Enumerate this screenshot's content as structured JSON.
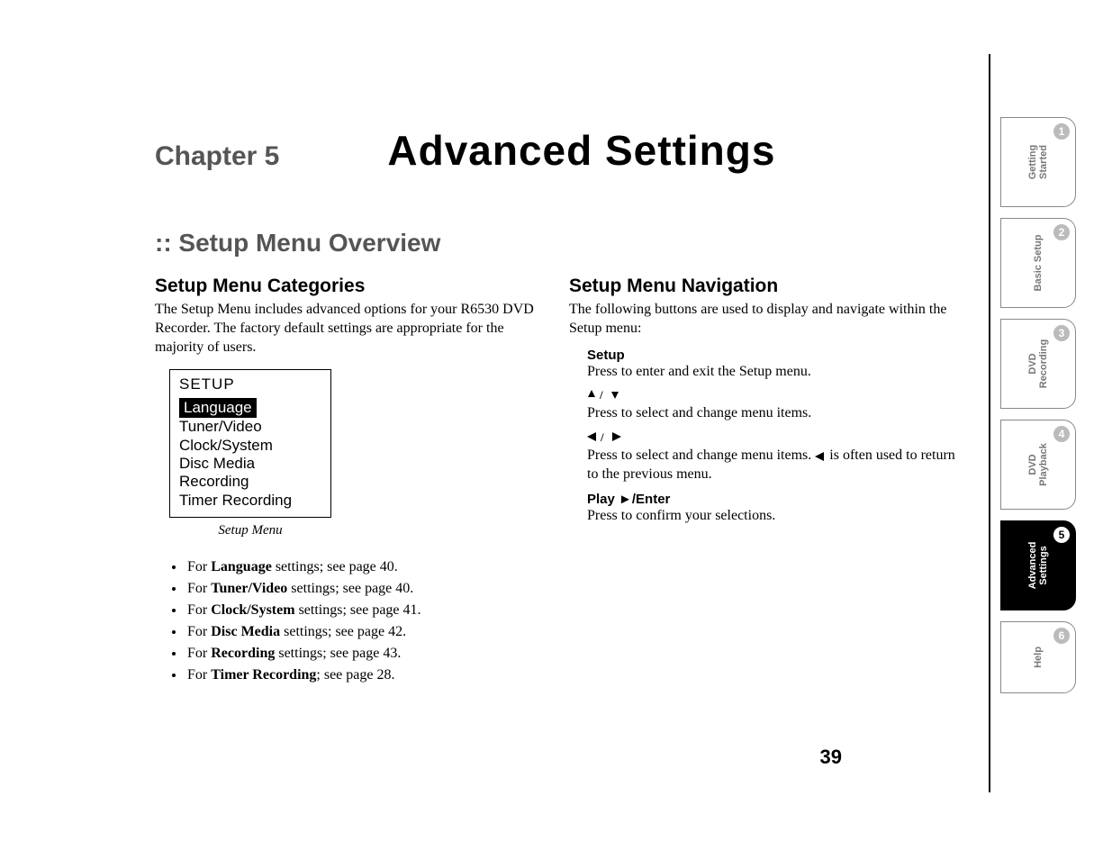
{
  "chapter": {
    "label": "Chapter 5",
    "title": "Advanced Settings"
  },
  "section_heading": ":: Setup Menu Overview",
  "left": {
    "heading": "Setup Menu Categories",
    "intro": "The Setup Menu includes advanced options for your R6530 DVD Recorder. The factory default settings are appropriate for the majority of users.",
    "menu": {
      "title": "SETUP",
      "items": [
        "Language",
        "Tuner/Video",
        "Clock/System",
        "Disc Media",
        "Recording",
        "Timer Recording"
      ],
      "caption": "Setup Menu"
    },
    "refs": [
      {
        "pre": "For ",
        "bold": "Language",
        "post": " settings; see page 40."
      },
      {
        "pre": "For ",
        "bold": "Tuner/Video",
        "post": " settings; see page 40."
      },
      {
        "pre": "For ",
        "bold": "Clock/System",
        "post": " settings; see page 41."
      },
      {
        "pre": "For ",
        "bold": "Disc Media",
        "post": " settings; see page 42."
      },
      {
        "pre": "For ",
        "bold": "Recording",
        "post": " settings; see page 43."
      },
      {
        "pre": "For ",
        "bold": "Timer Recording",
        "post": "; see page 28."
      }
    ]
  },
  "right": {
    "heading": "Setup Menu Navigation",
    "intro": "The following buttons are used to display and navigate within the Setup menu:",
    "items": [
      {
        "term": "Setup",
        "desc": "Press to enter and exit the Setup menu."
      },
      {
        "term_icons": "↑ / ↓",
        "desc": "Press to select and change menu items."
      },
      {
        "term_icons": "← / →",
        "desc_pre": "Press to select and change menu items. ",
        "desc_icon": "←",
        "desc_post": " is often used to return to the previous menu."
      },
      {
        "term": "Play ►/Enter",
        "desc": "Press to confirm your selections."
      }
    ]
  },
  "page_number": "39",
  "tabs": [
    {
      "num": "1",
      "label": "Getting\nStarted"
    },
    {
      "num": "2",
      "label": "Basic Setup"
    },
    {
      "num": "3",
      "label": "DVD\nRecording"
    },
    {
      "num": "4",
      "label": "DVD\nPlayback"
    },
    {
      "num": "5",
      "label": "Advanced\nSettings",
      "active": true
    },
    {
      "num": "6",
      "label": "Help",
      "help": true
    }
  ]
}
